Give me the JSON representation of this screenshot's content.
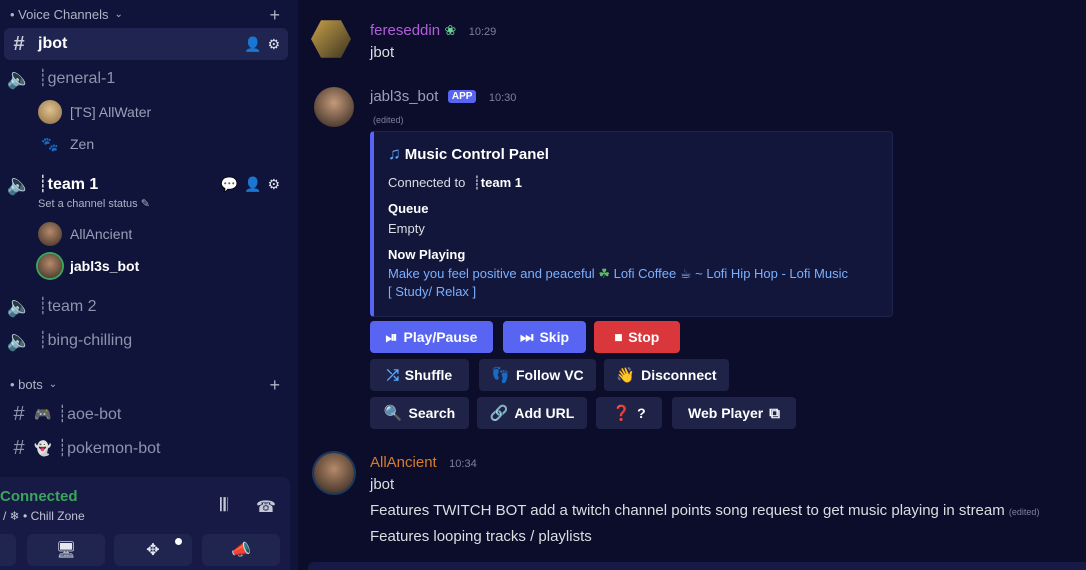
{
  "sidebar": {
    "voice_category": "• Voice Channels",
    "bots_category": "• bots",
    "channels": {
      "jbot": "jbot",
      "general": "┊general-1",
      "team1": "┊team 1",
      "team1_status": "Set a channel status",
      "team2": "┊team 2",
      "bing": "┊bing-chilling",
      "aoe": "┊aoe-bot",
      "pokemon": "┊pokemon-bot"
    },
    "voice_users": {
      "allwater": "[TS] AllWater",
      "zen": "Zen",
      "allancient": "AllAncient",
      "jabl3s": "jabl3s_bot"
    },
    "voice_panel": {
      "status": "Connected",
      "subtitle": "/ ❄ • Chill Zone"
    }
  },
  "messages": [
    {
      "author": "fereseddin",
      "author_color": "#b15fd8",
      "time": "10:29",
      "text": "jbot"
    },
    {
      "author": "jabl3s_bot",
      "app_badge": "APP",
      "time": "10:30",
      "edited": "(edited)"
    },
    {
      "author": "AllAncient",
      "author_color": "#d97c2a",
      "time": "10:34",
      "line1": "jbot",
      "line2": "Features TWITCH BOT  add a twitch channel points song request to get music playing in stream",
      "line2_edited": "(edited)",
      "line3": "Features looping tracks / playlists"
    }
  ],
  "embed": {
    "title": "Music Control Panel",
    "connected_label": "Connected to",
    "connected_channel": "┊team 1",
    "queue_label": "Queue",
    "queue_value": "Empty",
    "now_playing_label": "Now Playing",
    "track_part1": "Make you feel positive and peaceful",
    "track_part2": "Lofi Coffee",
    "track_part3": "~ Lofi Hip Hop - Lofi Music",
    "track_part4": "[ Study/ Relax ]"
  },
  "buttons": {
    "play_pause": "Play/Pause",
    "skip": "Skip",
    "stop": "Stop",
    "shuffle": "Shuffle",
    "follow_vc": "Follow VC",
    "disconnect": "Disconnect",
    "search": "Search",
    "add_url": "Add URL",
    "help": "?",
    "web_player": "Web Player"
  },
  "colors": {
    "accent": "#5865f2",
    "danger": "#da373c",
    "connected": "#3ba55c",
    "link": "#7ab0ff"
  }
}
